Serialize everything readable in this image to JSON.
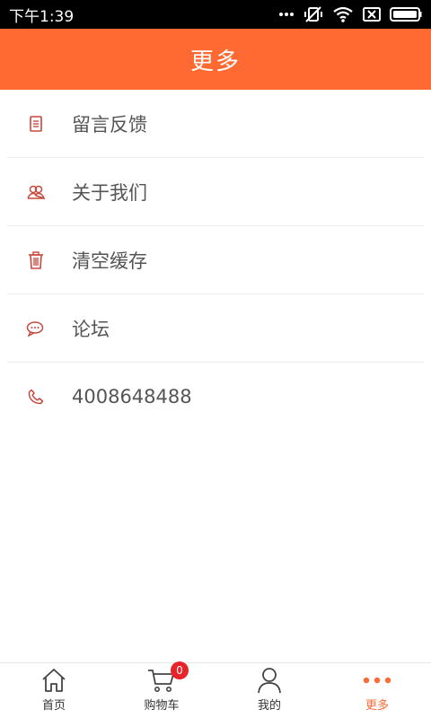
{
  "status_bar": {
    "time": "下午1:39"
  },
  "header": {
    "title": "更多"
  },
  "menu": {
    "items": [
      {
        "label": "留言反馈",
        "icon": "document-icon"
      },
      {
        "label": "关于我们",
        "icon": "users-icon"
      },
      {
        "label": "清空缓存",
        "icon": "trash-icon"
      },
      {
        "label": "论坛",
        "icon": "chat-icon"
      },
      {
        "label": "4008648488",
        "icon": "phone-icon"
      }
    ]
  },
  "tabbar": {
    "tabs": [
      {
        "label": "首页",
        "icon": "home-icon"
      },
      {
        "label": "购物车",
        "icon": "cart-icon",
        "badge": "0"
      },
      {
        "label": "我的",
        "icon": "user-icon"
      },
      {
        "label": "更多",
        "icon": "more-dots-icon",
        "active": true
      }
    ]
  },
  "colors": {
    "accent": "#ff6a33",
    "icon_red": "#c9463d",
    "badge": "#e8242a"
  }
}
